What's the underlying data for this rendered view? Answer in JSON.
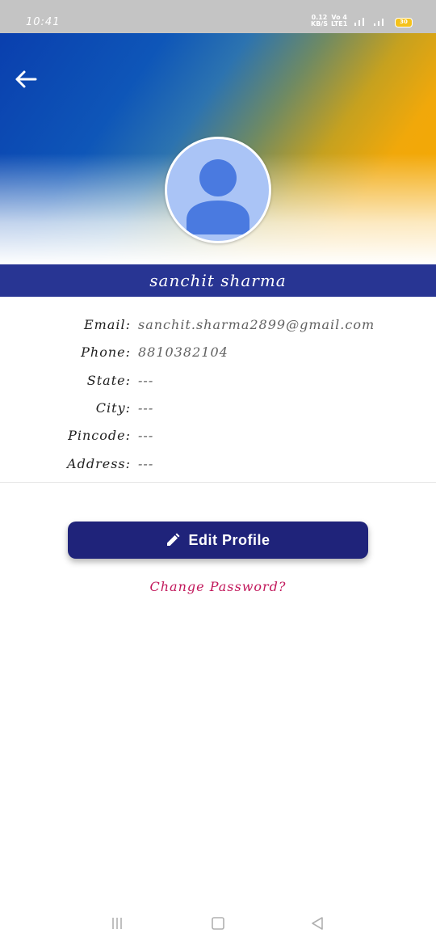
{
  "status_bar": {
    "time": "10:41",
    "speed_value": "0.12",
    "speed_unit": "KB/S",
    "volte_top": "Vo 4",
    "volte_bottom": "LTE1",
    "battery_level": "30"
  },
  "profile": {
    "name": "sanchit sharma",
    "fields": [
      {
        "label": "Email:",
        "value": "sanchit.sharma2899@gmail.com"
      },
      {
        "label": "Phone:",
        "value": "8810382104"
      },
      {
        "label": "State:",
        "value": "---"
      },
      {
        "label": "City:",
        "value": "---"
      },
      {
        "label": "Pincode:",
        "value": "---"
      },
      {
        "label": "Address:",
        "value": "---"
      }
    ]
  },
  "actions": {
    "edit_profile_label": "Edit Profile",
    "change_password_label": "Change Password?"
  },
  "colors": {
    "name_bar": "#283593",
    "edit_button": "#1f237a",
    "change_password_text": "#c2185b",
    "avatar_background": "#aac4f6",
    "avatar_figure": "#4a7ae0"
  },
  "icons": {
    "back": "arrow-left-icon",
    "avatar": "person-icon",
    "edit": "pencil-icon",
    "nav_recent": "menu-lines-icon",
    "nav_home": "square-icon",
    "nav_back": "triangle-left-icon"
  }
}
